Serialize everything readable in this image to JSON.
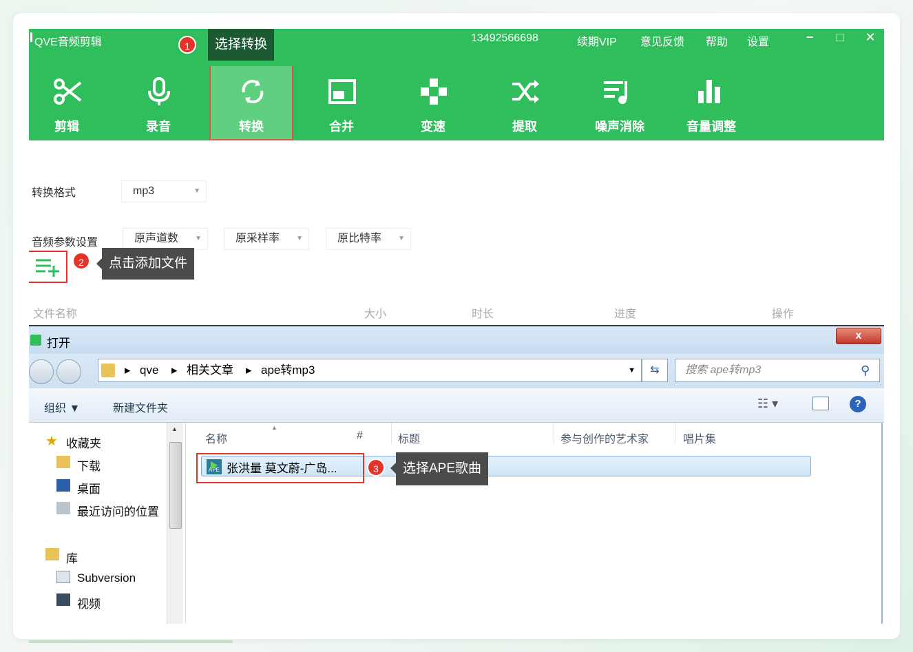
{
  "app": {
    "title": "QVE音频剪辑",
    "phone": "13492566698",
    "menu": [
      "续期VIP",
      "意见反馈",
      "帮助",
      "设置"
    ],
    "window_controls": [
      "−",
      "□",
      "✕"
    ]
  },
  "toolbar": [
    {
      "label": "剪辑",
      "icon": "scissors-icon"
    },
    {
      "label": "录音",
      "icon": "microphone-icon"
    },
    {
      "label": "转换",
      "icon": "convert-icon",
      "active": true
    },
    {
      "label": "合并",
      "icon": "merge-icon"
    },
    {
      "label": "变速",
      "icon": "speed-icon"
    },
    {
      "label": "提取",
      "icon": "shuffle-icon"
    },
    {
      "label": "噪声消除",
      "icon": "noise-icon"
    },
    {
      "label": "音量调整",
      "icon": "volume-bars-icon"
    }
  ],
  "steps": [
    {
      "num": "1",
      "text": "选择转换"
    },
    {
      "num": "2",
      "text": "点击添加文件"
    },
    {
      "num": "3",
      "text": "选择APE歌曲"
    }
  ],
  "form": {
    "format_label": "转换格式",
    "format_value": "mp3",
    "params_label": "音频参数设置",
    "channels": "原声道数",
    "sample_rate": "原采样率",
    "bitrate": "原比特率"
  },
  "file_table_headers": [
    "文件名称",
    "大小",
    "时长",
    "进度",
    "操作"
  ],
  "dialog": {
    "title": "打开",
    "close": "x",
    "path": [
      "qve",
      "相关文章",
      "ape转mp3"
    ],
    "search_placeholder": "搜索 ape转mp3",
    "organize": "组织 ▼",
    "new_folder": "新建文件夹",
    "sidebar": [
      {
        "label": "收藏夹",
        "icon": "star-icon"
      },
      {
        "label": "下载",
        "icon": "download-folder-icon"
      },
      {
        "label": "桌面",
        "icon": "desktop-icon"
      },
      {
        "label": "最近访问的位置",
        "icon": "recent-places-icon"
      },
      {
        "label": "库",
        "icon": "library-icon"
      },
      {
        "label": "Subversion",
        "icon": "document-icon"
      },
      {
        "label": "视频",
        "icon": "video-icon"
      }
    ],
    "columns": [
      "名称",
      "#",
      "标题",
      "参与创作的艺术家",
      "唱片集"
    ],
    "files": [
      {
        "name": "张洪量 莫文蔚-广岛...",
        "type_badge": "APE"
      }
    ]
  },
  "colors": {
    "brand_green": "#2fbe5b",
    "step_red": "#e6332a"
  }
}
